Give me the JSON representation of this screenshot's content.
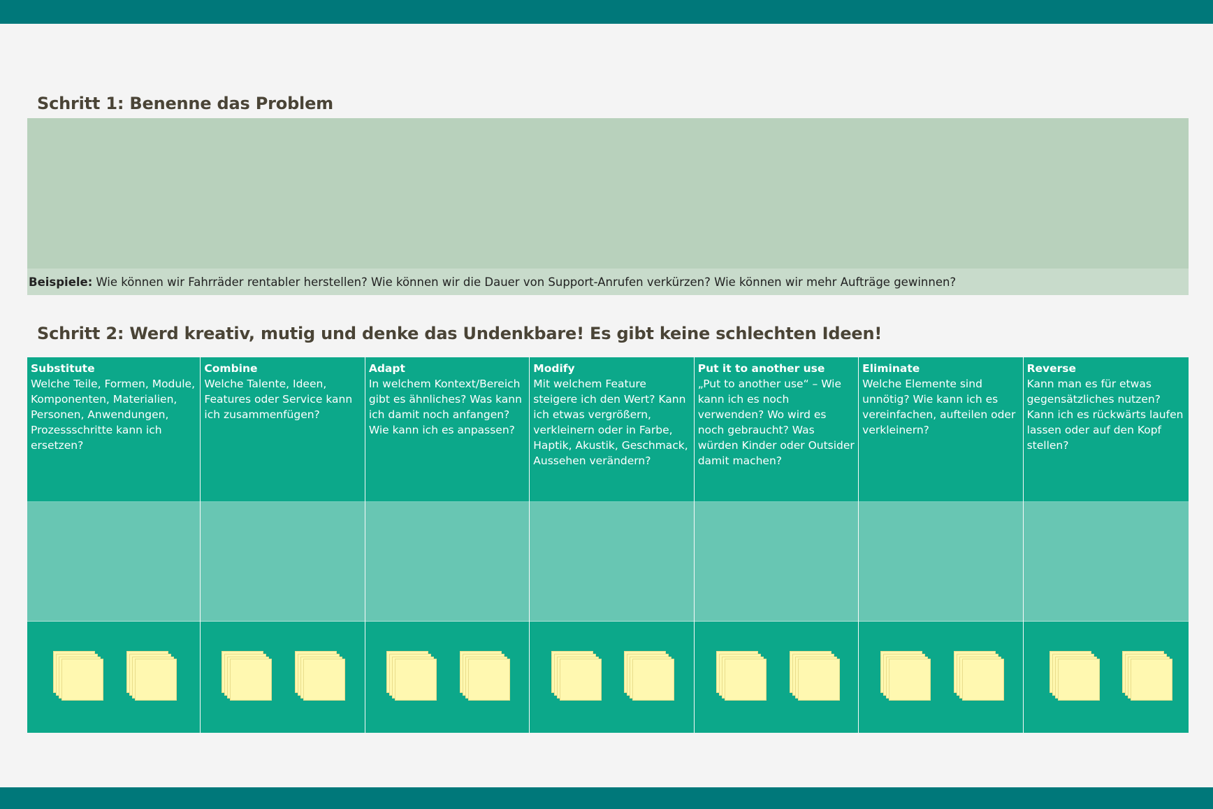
{
  "step1": {
    "title": "Schritt 1: Benenne das Problem",
    "examples_label": "Beispiele:",
    "examples_text": "Wie können wir Fahrräder rentabler herstellen? Wie können wir die Dauer von Support-Anrufen verkürzen? Wie können wir mehr Aufträge gewinnen?"
  },
  "step2": {
    "title": "Schritt 2: Werd kreativ, mutig und denke das Undenkbare! Es gibt keine schlechten Ideen!",
    "columns": [
      {
        "name": "Substitute",
        "question": "Welche Teile, Formen, Module, Komponenten, Materialien, Personen, Anwendungen, Prozessschritte kann ich ersetzen?"
      },
      {
        "name": "Combine",
        "question": "Welche Talente, Ideen, Features oder Service kann ich  zusammenfügen?"
      },
      {
        "name": "Adapt",
        "question": "In welchem Kontext/Bereich gibt es ähnliches? Was kann ich damit noch anfangen? Wie kann ich es anpassen?"
      },
      {
        "name": "Modify",
        "question": "Mit welchem Feature steigere ich den Wert? Kann ich etwas vergrößern, verkleinern oder in Farbe, Haptik, Akustik, Geschmack, Aussehen verändern?"
      },
      {
        "name": "Put it to another use",
        "question": "„Put to another use“ – Wie kann ich es noch verwenden? Wo wird es noch gebraucht? Was würden Kinder oder Outsider damit machen?"
      },
      {
        "name": "Eliminate",
        "question": "Welche Elemente sind unnötig? Wie kann ich es vereinfachen, aufteilen oder verkleinern?"
      },
      {
        "name": "Reverse",
        "question": "Kann man es für etwas gegensätzliches nutzen? Kann ich es rückwärts laufen lassen oder auf den Kopf stellen?"
      }
    ]
  },
  "colors": {
    "header_bar": "#00787a",
    "column_header": "#0ca88a",
    "ideas_area": "#68c6b3",
    "problem_area": "#b8d1bc",
    "sticky_note": "#fff8b0",
    "title_text": "#4a4436"
  }
}
